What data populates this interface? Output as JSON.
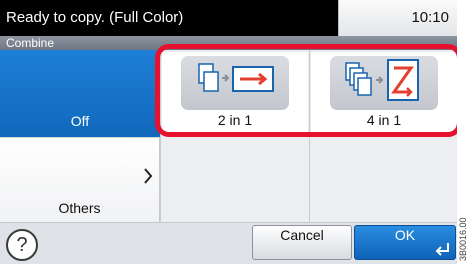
{
  "status": {
    "message": "Ready to copy. (Full Color)",
    "time": "10:10"
  },
  "function": {
    "title": "Combine"
  },
  "categories": [
    {
      "label": "Off",
      "selected": true
    },
    {
      "label": "Others",
      "selected": false
    }
  ],
  "options": [
    {
      "label": "2 in 1",
      "icon": "combine-2in1-icon"
    },
    {
      "label": "4 in 1",
      "icon": "combine-4in1-icon"
    }
  ],
  "buttons": {
    "help": "?",
    "cancel": "Cancel",
    "ok": "OK"
  },
  "side_code": "3B0016.00",
  "colors": {
    "selected_blue": "#1168bb",
    "highlight_red": "#e8112d",
    "status_black": "#000000"
  }
}
